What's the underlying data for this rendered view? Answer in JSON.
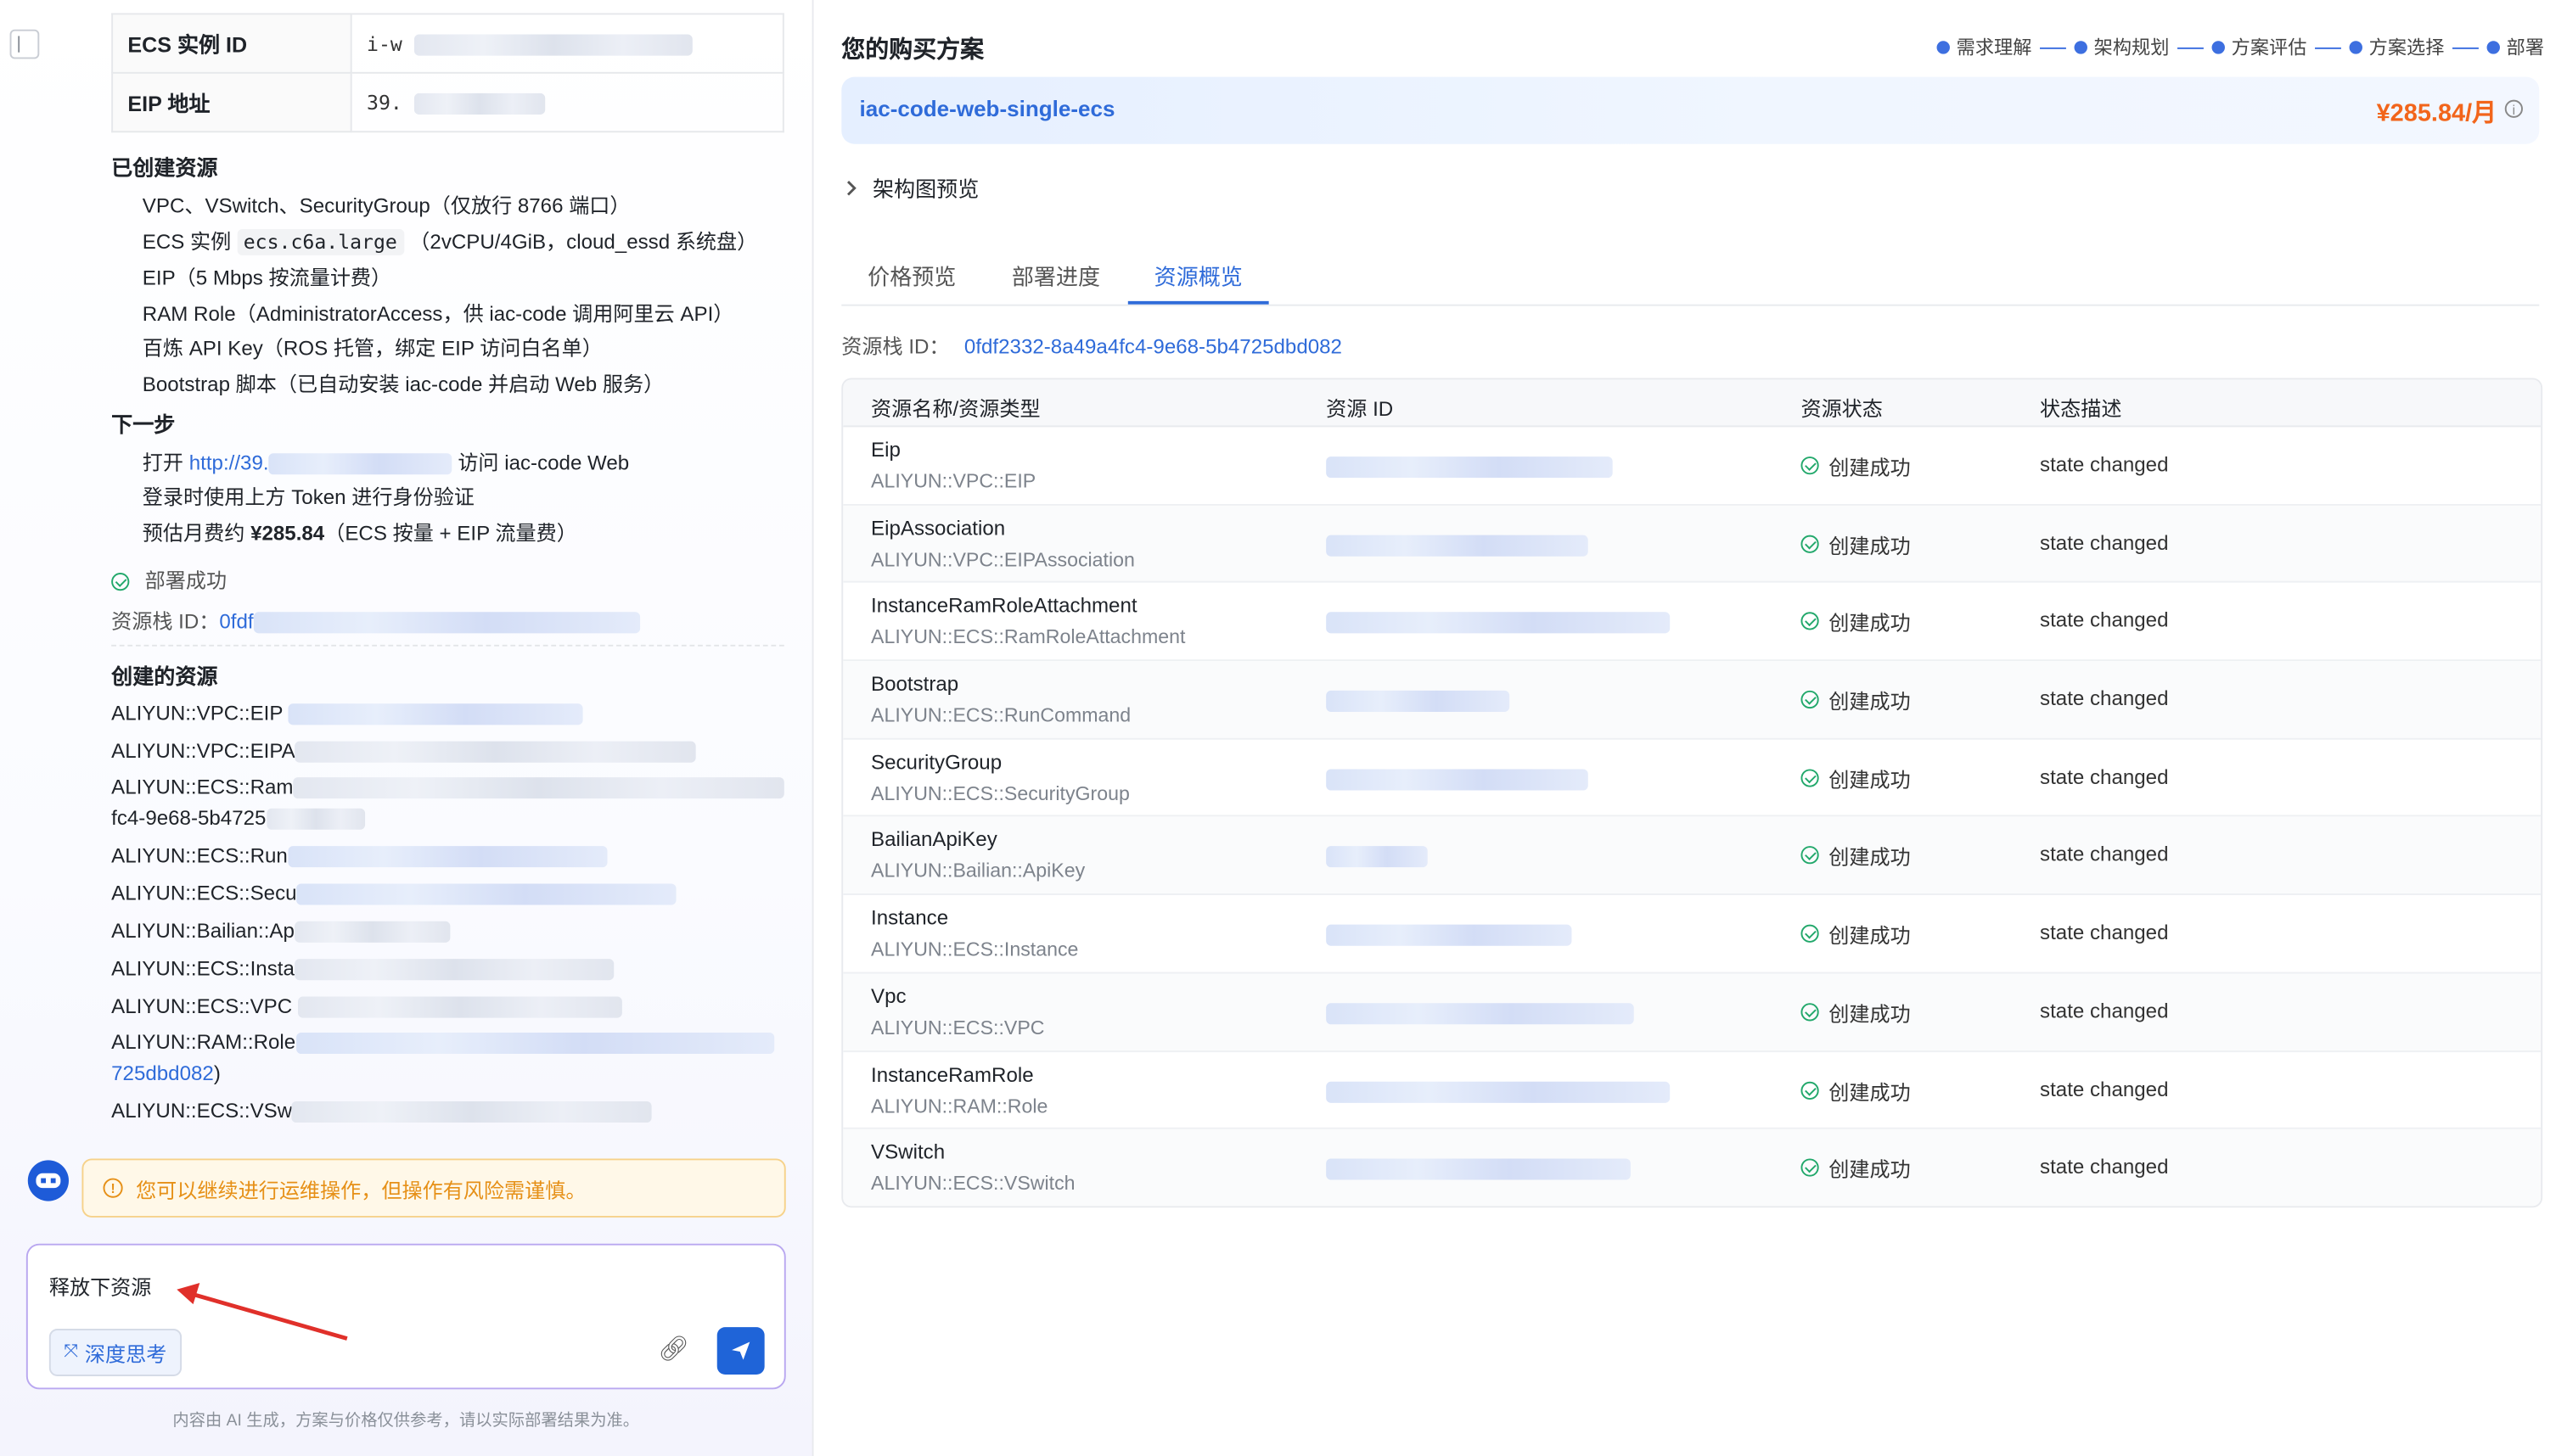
{
  "left": {
    "kv_rows": [
      {
        "key": "ECS 实例 ID",
        "value": "i-w"
      },
      {
        "key": "EIP 地址",
        "value": "39."
      }
    ],
    "created_heading": "已创建资源",
    "created_items": [
      "VPC、VSwitch、SecurityGroup（仅放行 8766 端口）",
      "ECS 实例",
      "ecs.c6a.large",
      "（2vCPU/4GiB，cloud_essd 系统盘）",
      "EIP（5 Mbps 按流量计费）",
      "RAM Role（AdministratorAccess，供 iac-code 调用阿里云 API）",
      "百炼 API Key（ROS 托管，绑定 EIP 访问白名单）",
      "Bootstrap 脚本（已自动安装 iac-code 并启动 Web 服务）"
    ],
    "next_heading": "下一步",
    "next_items": {
      "open_prefix": "打开",
      "open_link": "http://39.",
      "open_suffix": "访问 iac-code Web",
      "token": "登录时使用上方 Token 进行身份验证",
      "estimate_prefix": "预估月费约",
      "estimate_price": "¥285.84",
      "estimate_suffix": "（ECS 按量 + EIP 流量费）"
    },
    "deploy_status": "部署成功",
    "stack_label": "资源栈 ID：",
    "stack_value": "0fdf",
    "resources_heading": "创建的资源",
    "resource_lines": [
      "ALIYUN::VPC::EIP",
      "ALIYUN::VPC::EIPA",
      "ALIYUN::ECS::Ram",
      "fc4-9e68-5b4725",
      "ALIYUN::ECS::Run",
      "ALIYUN::ECS::Secu",
      "ALIYUN::Bailian::Ap",
      "ALIYUN::ECS::Insta",
      "ALIYUN::ECS::VPC",
      "ALIYUN::RAM::Role",
      "725dbd082",
      ")",
      "ALIYUN::ECS::VSw"
    ],
    "warning": "您可以继续进行运维操作，但操作有风险需谨慎。",
    "input_value": "释放下资源",
    "deep_think_label": "深度思考",
    "disclaimer": "内容由 AI 生成，方案与价格仅供参考，请以实际部署结果为准。"
  },
  "right": {
    "plan_title": "您的购买方案",
    "steps": [
      "需求理解",
      "架构规划",
      "方案评估",
      "方案选择",
      "部署"
    ],
    "plan_name": "iac-code-web-single-ecs",
    "plan_price": "¥285.84/月",
    "arch_preview": "架构图预览",
    "tabs": [
      "价格预览",
      "部署进度",
      "资源概览"
    ],
    "active_tab": "资源概览",
    "stack_label": "资源栈 ID：",
    "stack_id": "0fdf2332-8a49a4fc4-9e68-5b4725dbd082",
    "table_headers": [
      "资源名称/资源类型",
      "资源 ID",
      "资源状态",
      "状态描述"
    ],
    "rows": [
      {
        "name": "Eip",
        "type": "ALIYUN::VPC::EIP",
        "status": "创建成功",
        "desc": "state changed"
      },
      {
        "name": "EipAssociation",
        "type": "ALIYUN::VPC::EIPAssociation",
        "status": "创建成功",
        "desc": "state changed"
      },
      {
        "name": "InstanceRamRoleAttachment",
        "type": "ALIYUN::ECS::RamRoleAttachment",
        "status": "创建成功",
        "desc": "state changed"
      },
      {
        "name": "Bootstrap",
        "type": "ALIYUN::ECS::RunCommand",
        "status": "创建成功",
        "desc": "state changed"
      },
      {
        "name": "SecurityGroup",
        "type": "ALIYUN::ECS::SecurityGroup",
        "status": "创建成功",
        "desc": "state changed"
      },
      {
        "name": "BailianApiKey",
        "type": "ALIYUN::Bailian::ApiKey",
        "status": "创建成功",
        "desc": "state changed"
      },
      {
        "name": "Instance",
        "type": "ALIYUN::ECS::Instance",
        "status": "创建成功",
        "desc": "state changed"
      },
      {
        "name": "Vpc",
        "type": "ALIYUN::ECS::VPC",
        "status": "创建成功",
        "desc": "state changed"
      },
      {
        "name": "InstanceRamRole",
        "type": "ALIYUN::RAM::Role",
        "status": "创建成功",
        "desc": "state changed"
      },
      {
        "name": "VSwitch",
        "type": "ALIYUN::ECS::VSwitch",
        "status": "创建成功",
        "desc": "state changed"
      }
    ]
  },
  "colors": {
    "accent": "#2f6bd9",
    "price": "#f2651b",
    "success": "#22a86b",
    "warning": "#e69017"
  },
  "icons": [
    "sidebar-toggle-icon",
    "check-circle-icon",
    "warning-icon",
    "bot-avatar",
    "attach-icon",
    "send-icon",
    "chevron-right-icon",
    "info-icon"
  ]
}
